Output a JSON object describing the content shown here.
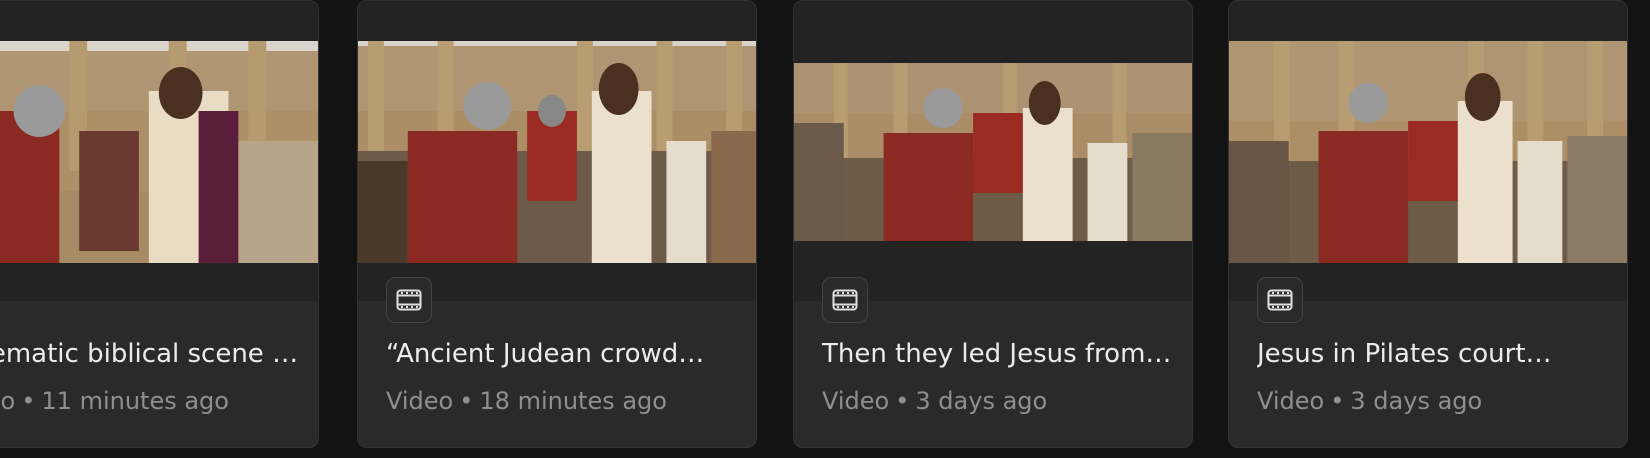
{
  "cards": [
    {
      "title": "Cinematic biblical scene i…",
      "type": "Video",
      "time": "11 minutes ago",
      "icon": "film-icon"
    },
    {
      "title": "“Ancient Judean crowd…",
      "type": "Video",
      "time": "18 minutes ago",
      "icon": "film-icon"
    },
    {
      "title": "Then they led Jesus from…",
      "type": "Video",
      "time": "3 days ago",
      "icon": "film-icon"
    },
    {
      "title": "Jesus in Pilates court…",
      "type": "Video",
      "time": "3 days ago",
      "icon": "film-icon"
    }
  ],
  "colors": {
    "background": "#131313",
    "card": "#2a2a2a",
    "title": "#ececec",
    "meta": "#8f8f8f"
  },
  "separator": "•"
}
